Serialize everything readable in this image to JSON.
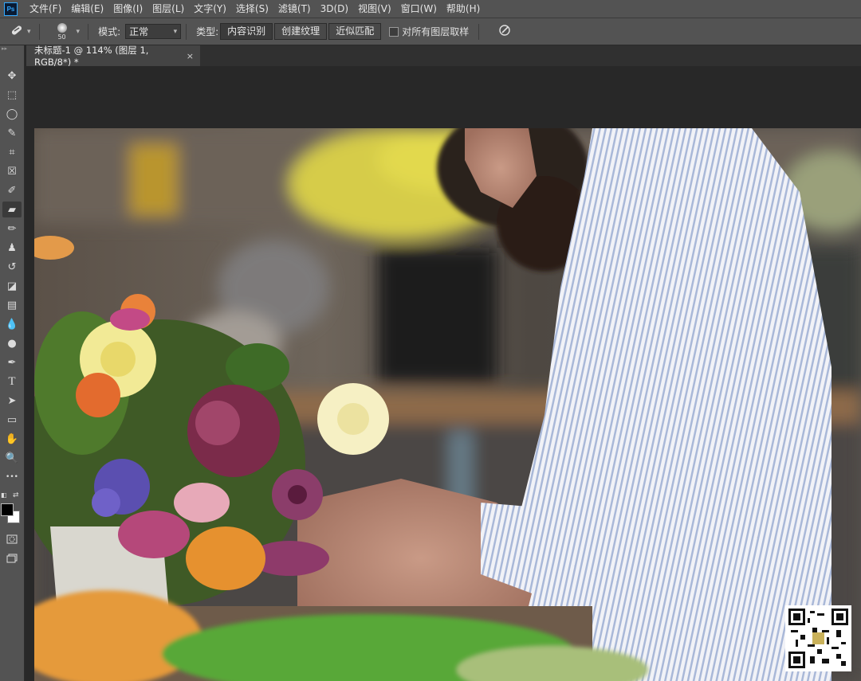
{
  "app": {
    "logo": "Ps"
  },
  "menu": [
    "文件(F)",
    "编辑(E)",
    "图像(I)",
    "图层(L)",
    "文字(Y)",
    "选择(S)",
    "滤镜(T)",
    "3D(D)",
    "视图(V)",
    "窗口(W)",
    "帮助(H)"
  ],
  "options": {
    "brush_size": "50",
    "mode_label": "模式:",
    "mode_value": "正常",
    "type_label": "类型:",
    "type_buttons": [
      "内容识别",
      "创建纹理",
      "近似匹配"
    ],
    "sample_all_label": "对所有图层取样"
  },
  "document": {
    "tab_title": "未标题-1 @ 114% (图层 1, RGB/8*) *",
    "close_glyph": "×"
  },
  "tools": [
    {
      "name": "move-tool",
      "glyph": "✥"
    },
    {
      "name": "marquee-tool",
      "glyph": "⬚"
    },
    {
      "name": "lasso-tool",
      "glyph": "◯"
    },
    {
      "name": "quick-select-tool",
      "glyph": "✎"
    },
    {
      "name": "crop-tool",
      "glyph": "⌗"
    },
    {
      "name": "frame-tool",
      "glyph": "☒"
    },
    {
      "name": "eyedropper-tool",
      "glyph": "✐"
    },
    {
      "name": "spot-healing-tool",
      "glyph": "▰"
    },
    {
      "name": "brush-tool",
      "glyph": "✏"
    },
    {
      "name": "stamp-tool",
      "glyph": "♟"
    },
    {
      "name": "history-brush-tool",
      "glyph": "↺"
    },
    {
      "name": "eraser-tool",
      "glyph": "◪"
    },
    {
      "name": "gradient-tool",
      "glyph": "▤"
    },
    {
      "name": "blur-tool",
      "glyph": "💧"
    },
    {
      "name": "dodge-tool",
      "glyph": "●"
    },
    {
      "name": "pen-tool",
      "glyph": "✒"
    },
    {
      "name": "type-tool",
      "glyph": "T"
    },
    {
      "name": "path-select-tool",
      "glyph": "➤"
    },
    {
      "name": "rectangle-tool",
      "glyph": "▭"
    },
    {
      "name": "hand-tool",
      "glyph": "✋"
    },
    {
      "name": "zoom-tool",
      "glyph": "🔍"
    },
    {
      "name": "more-tools",
      "glyph": "•••"
    }
  ],
  "colors": {
    "foreground": "#000000",
    "background": "#ffffff",
    "ui_panel": "#535353",
    "workspace": "#282828"
  }
}
